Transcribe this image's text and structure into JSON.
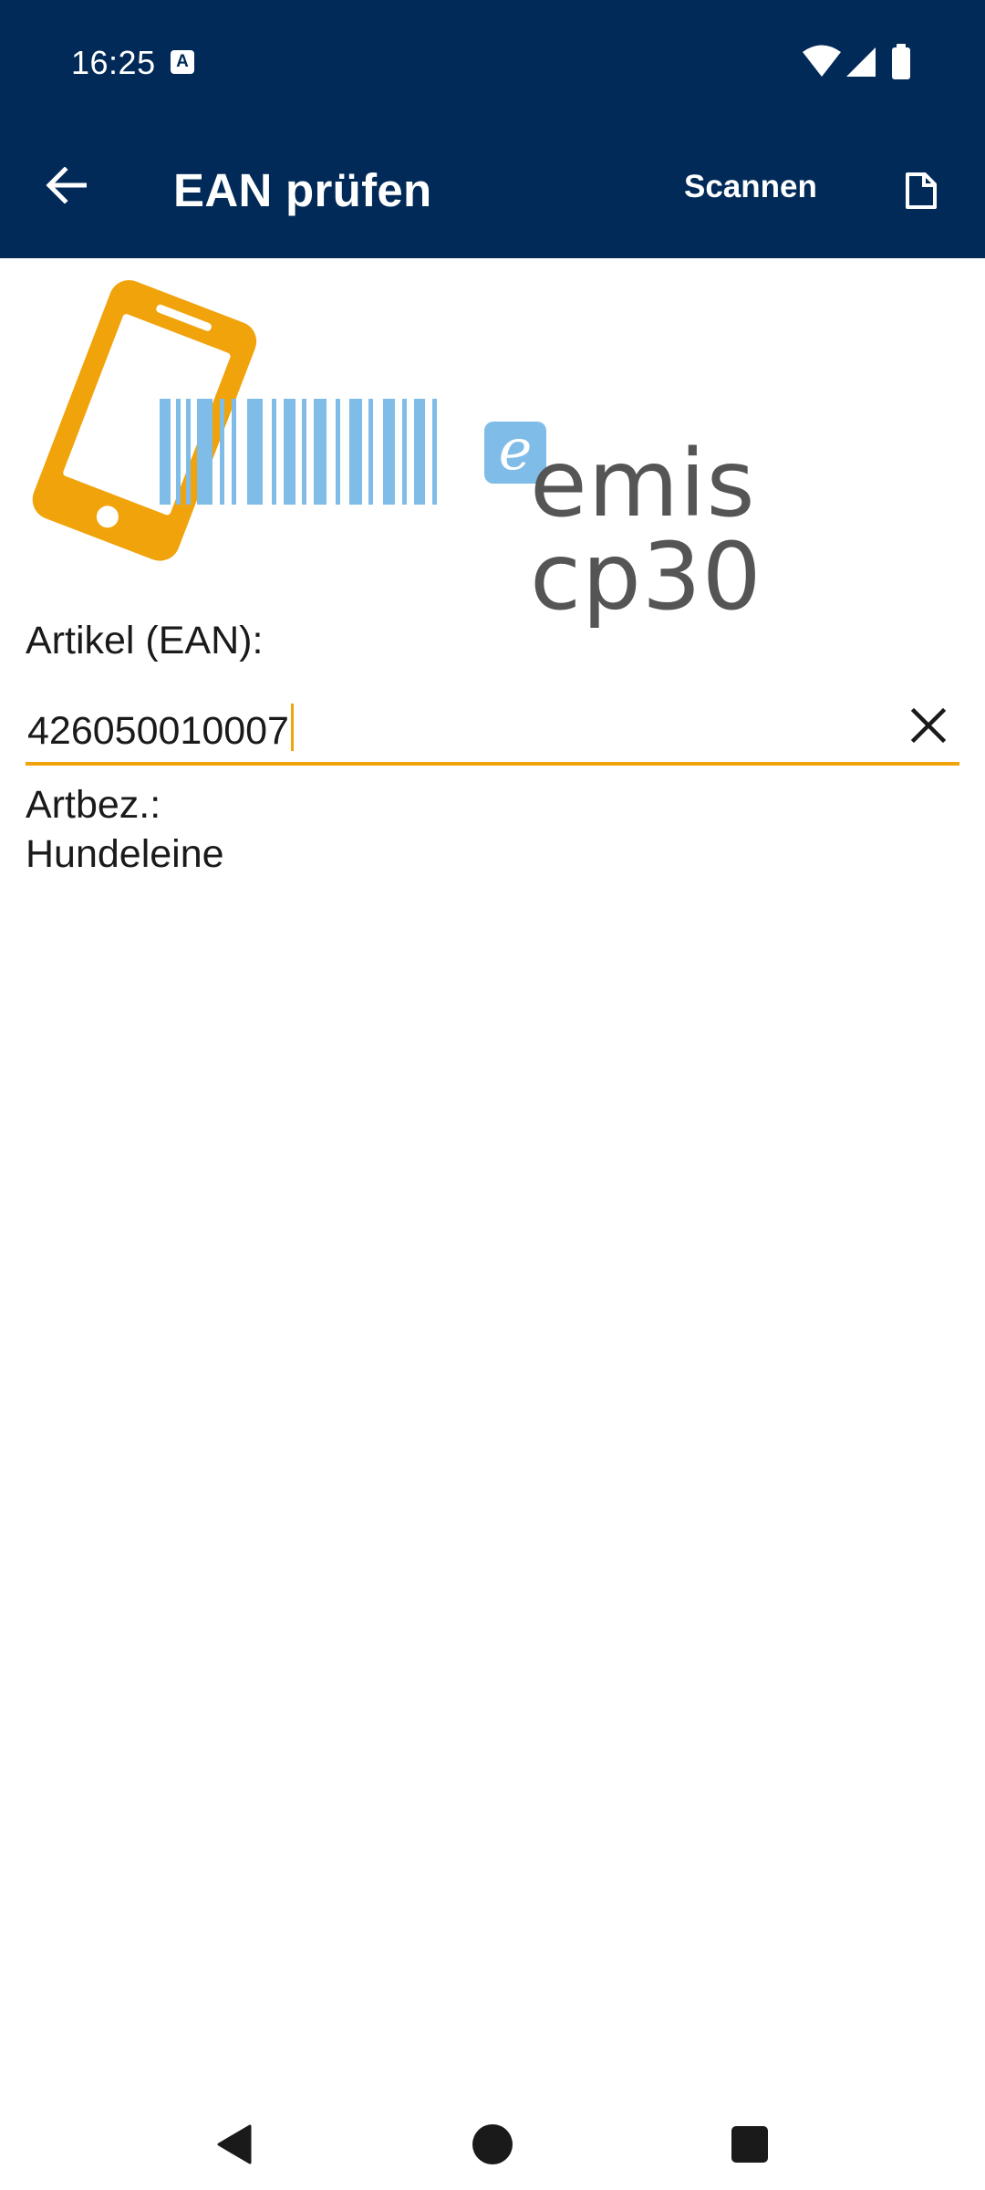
{
  "status_bar": {
    "time": "16:25",
    "icons": [
      "a-notification-icon",
      "wifi-icon",
      "cellular-signal-icon",
      "battery-icon"
    ]
  },
  "app_bar": {
    "title": "EAN prüfen",
    "scan_label": "Scannen",
    "back_icon": "arrow-back-icon",
    "doc_icon": "document-icon"
  },
  "logo": {
    "badge_letter": "e",
    "text": "emis cp30",
    "colors": {
      "phone": "#f0a30a",
      "barcode": "#7fbde8",
      "text": "#555555"
    }
  },
  "form": {
    "ean_label": "Artikel (EAN):",
    "ean_value": "426050010007",
    "description_label": "Artbez.:",
    "description_value": "Hundeleine"
  },
  "nav_bar": {
    "items": [
      "back-triangle-icon",
      "home-circle-icon",
      "recents-square-icon"
    ]
  },
  "colors": {
    "primary": "#012a58",
    "accent": "#f0a30a"
  }
}
